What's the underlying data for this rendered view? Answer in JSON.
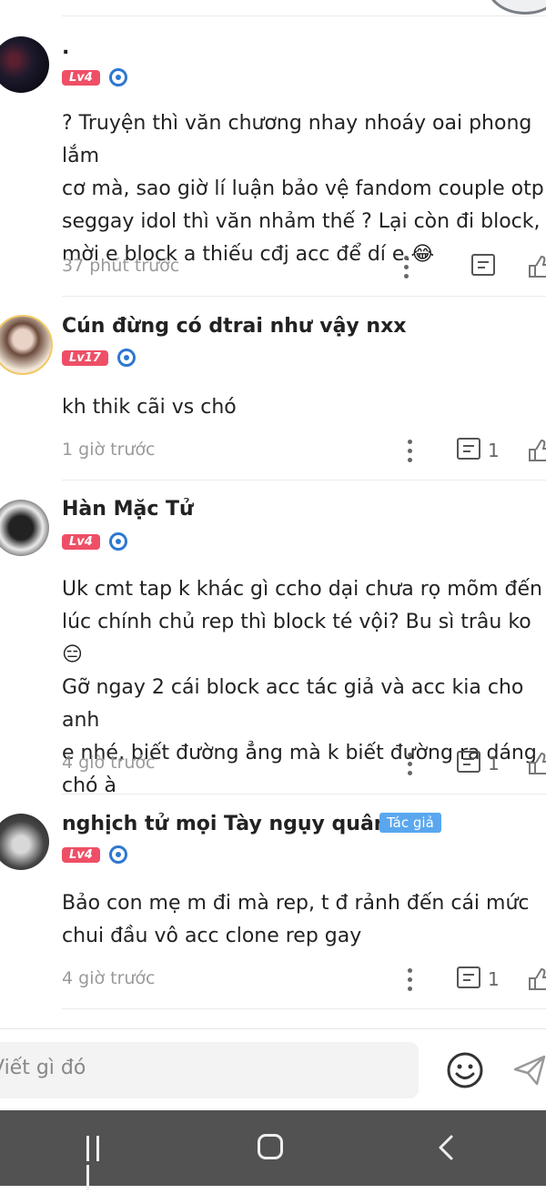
{
  "comments": [
    {
      "username": ".",
      "level": "Lv4",
      "text_lines": [
        "? Truyện thì văn chương nhay nhoáy oai phong lắm",
        "cơ mà, sao giờ lí luận bảo vệ fandom couple otp",
        "seggay idol thì văn nhảm thế ? Lại còn đi block,",
        "mời e block a thiếu cđj acc để dí e.😂"
      ],
      "time": "37 phút trước",
      "reply_count": ""
    },
    {
      "username": "Cún đừng có dtrai như vậy nxx",
      "level": "Lv17",
      "text_lines": [
        "kh thik cãi vs chó"
      ],
      "time": "1 giờ trước",
      "reply_count": "1"
    },
    {
      "username": "Hàn Mặc Tử",
      "level": "Lv4",
      "text_lines": [
        "Uk cmt tap k khác gì ccho dại chưa rọ mõm đến",
        "lúc chính chủ rep thì block té vội? Bu sì trâu ko 😑",
        "Gỡ ngay 2 cái block acc tác giả và acc kia cho anh",
        "e nhé, biết đường ẳng mà k biết đường ra dáng",
        "chó à"
      ],
      "time": "4 giờ trước",
      "reply_count": "1"
    },
    {
      "username": "nghịch tử mọi Tày ngụy quân tử",
      "author_badge": "Tác giả",
      "level": "Lv4",
      "text_lines": [
        "Bảo con mẹ m đi mà rep, t đ rảnh đến cái mức",
        "chui đầu vô acc clone rep gay"
      ],
      "time": "4 giờ trước",
      "reply_count": "1"
    }
  ],
  "input": {
    "placeholder": "Viết gì đó"
  },
  "icons": {
    "more": "more-vertical-icon",
    "reply": "comment-icon",
    "like": "thumbs-up-icon",
    "emoji": "smiley-icon",
    "send": "send-icon"
  },
  "colors": {
    "level_badge": "#ee4f66",
    "author_badge": "#5aa7ef",
    "medal": "#2e78d0",
    "nav_bar": "#525252"
  }
}
